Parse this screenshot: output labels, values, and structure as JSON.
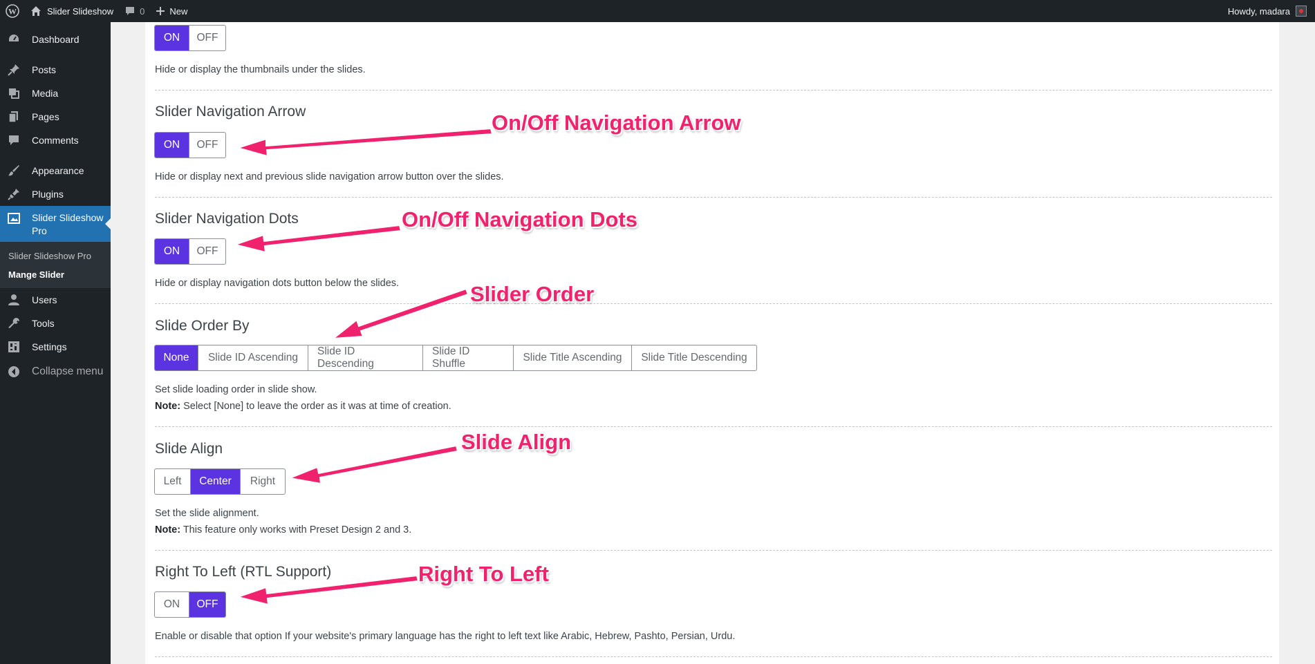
{
  "adminbar": {
    "site_name": "Slider Slideshow",
    "comments_count": "0",
    "new_label": "New",
    "howdy": "Howdy, madara"
  },
  "sidebar": {
    "items": [
      {
        "label": "Dashboard",
        "icon": "dashboard-icon"
      },
      {
        "label": "Posts",
        "icon": "pin-icon"
      },
      {
        "label": "Media",
        "icon": "media-icon"
      },
      {
        "label": "Pages",
        "icon": "pages-icon"
      },
      {
        "label": "Comments",
        "icon": "comment-icon"
      },
      {
        "label": "Appearance",
        "icon": "paintbrush-icon"
      },
      {
        "label": "Plugins",
        "icon": "plugin-icon"
      },
      {
        "label": "Slider Slideshow Pro",
        "icon": "slider-icon"
      },
      {
        "label": "Users",
        "icon": "user-icon"
      },
      {
        "label": "Tools",
        "icon": "wrench-icon"
      },
      {
        "label": "Settings",
        "icon": "settings-icon"
      },
      {
        "label": "Collapse menu",
        "icon": "collapse-icon"
      }
    ],
    "submenu": [
      "Slider Slideshow Pro",
      "Mange Slider"
    ]
  },
  "settings": {
    "thumbnails": {
      "options": [
        "ON",
        "OFF"
      ],
      "selected": "ON",
      "desc": "Hide or display the thumbnails under the slides."
    },
    "nav_arrow": {
      "title": "Slider Navigation Arrow",
      "options": [
        "ON",
        "OFF"
      ],
      "selected": "ON",
      "desc": "Hide or display next and previous slide navigation arrow button over the slides."
    },
    "nav_dots": {
      "title": "Slider Navigation Dots",
      "options": [
        "ON",
        "OFF"
      ],
      "selected": "ON",
      "desc": "Hide or display navigation dots button below the slides."
    },
    "order_by": {
      "title": "Slide Order By",
      "options": [
        "None",
        "Slide ID Ascending",
        "Slide ID Descending",
        "Slide ID Shuffle",
        "Slide Title Ascending",
        "Slide Title Descending"
      ],
      "selected": "None",
      "desc": "Set slide loading order in slide show.",
      "note_label": "Note:",
      "note": " Select [None] to leave the order as it was at time of creation."
    },
    "align": {
      "title": "Slide Align",
      "options": [
        "Left",
        "Center",
        "Right"
      ],
      "selected": "Center",
      "desc": "Set the slide alignment.",
      "note_label": "Note:",
      "note": " This feature only works with Preset Design 2 and 3."
    },
    "rtl": {
      "title": "Right To Left (RTL Support)",
      "options": [
        "ON",
        "OFF"
      ],
      "selected": "OFF",
      "desc": "Enable or disable that option If your website's primary language has the right to left text like Arabic, Hebrew, Pashto, Persian, Urdu."
    }
  },
  "annotations": {
    "nav_arrow": "On/Off Navigation Arrow",
    "nav_dots": "On/Off Navigation Dots",
    "order": "Slider Order",
    "align": "Slide Align",
    "rtl": "Right To Left"
  },
  "colors": {
    "accent": "#5b33e0",
    "annotation": "#f0226e",
    "admin_dark": "#1d2327",
    "menu_active": "#2271b1"
  }
}
